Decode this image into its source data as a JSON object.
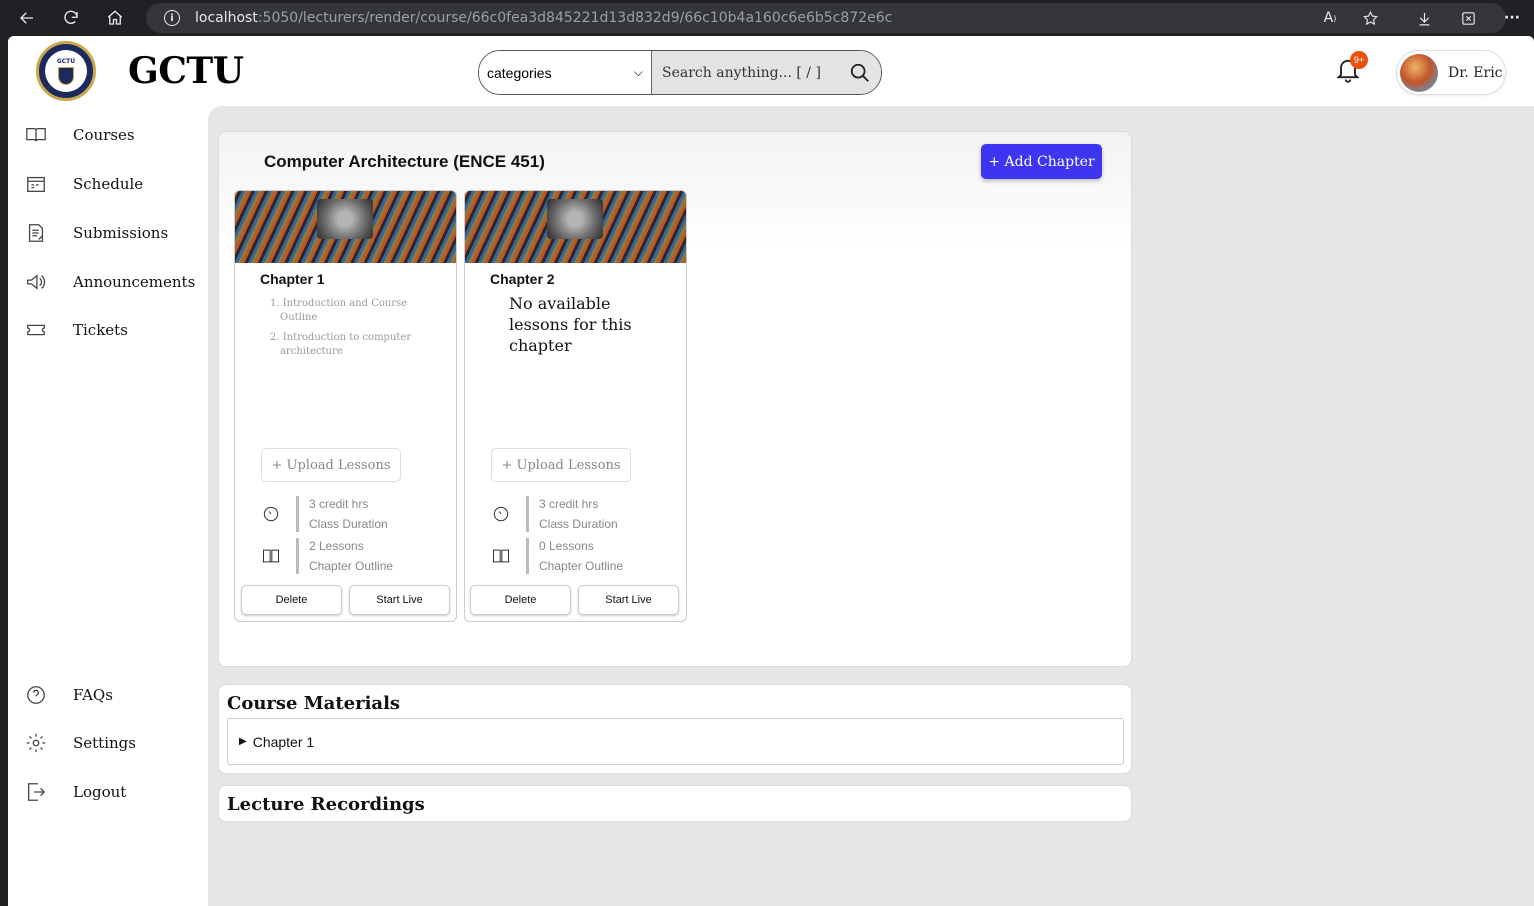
{
  "browser": {
    "url_host": "localhost",
    "url_path": ":5050/lecturers/render/course/66c0fea3d845221d13d832d9/66c10b4a160c6e6b5c872e6c"
  },
  "header": {
    "brand": "GCTU",
    "logo_text": "GCTU",
    "category_select": "categories",
    "search_placeholder": "Search anything... [ / ]",
    "notification_badge": "9+",
    "user_name": "Dr. Eric"
  },
  "sidebar": {
    "items": [
      {
        "label": "Courses",
        "icon": "book-icon"
      },
      {
        "label": "Schedule",
        "icon": "calendar-icon"
      },
      {
        "label": "Submissions",
        "icon": "document-icon"
      },
      {
        "label": "Announcements",
        "icon": "megaphone-icon"
      },
      {
        "label": "Tickets",
        "icon": "ticket-icon"
      }
    ],
    "bottom_items": [
      {
        "label": "FAQs",
        "icon": "question-icon"
      },
      {
        "label": "Settings",
        "icon": "gear-icon"
      },
      {
        "label": "Logout",
        "icon": "logout-icon"
      }
    ]
  },
  "course": {
    "title": "Computer Architecture (ENCE 451)",
    "add_chapter_label": "+ Add Chapter",
    "chapters": [
      {
        "name": "Chapter 1",
        "lessons": [
          "1. Introduction and Course Outline",
          "2. Introduction to computer architecture"
        ],
        "no_lessons_text": "",
        "upload_label": "+ Upload Lessons",
        "credit_value": "3 credit hrs",
        "credit_label": "Class Duration",
        "lesson_count": "2 Lessons",
        "lesson_count_label": "Chapter Outline",
        "delete_label": "Delete",
        "start_live_label": "Start Live"
      },
      {
        "name": "Chapter 2",
        "lessons": [],
        "no_lessons_text": "No available lessons for this chapter",
        "upload_label": "+ Upload Lessons",
        "credit_value": "3 credit hrs",
        "credit_label": "Class Duration",
        "lesson_count": "0 Lessons",
        "lesson_count_label": "Chapter Outline",
        "delete_label": "Delete",
        "start_live_label": "Start Live"
      }
    ]
  },
  "materials": {
    "title": "Course Materials",
    "accordion_label": "Chapter 1"
  },
  "recordings": {
    "title": "Lecture Recordings"
  },
  "colors": {
    "accent": "#3d35f0",
    "badge": "#e8520e",
    "main_bg": "#e6e6e6"
  }
}
